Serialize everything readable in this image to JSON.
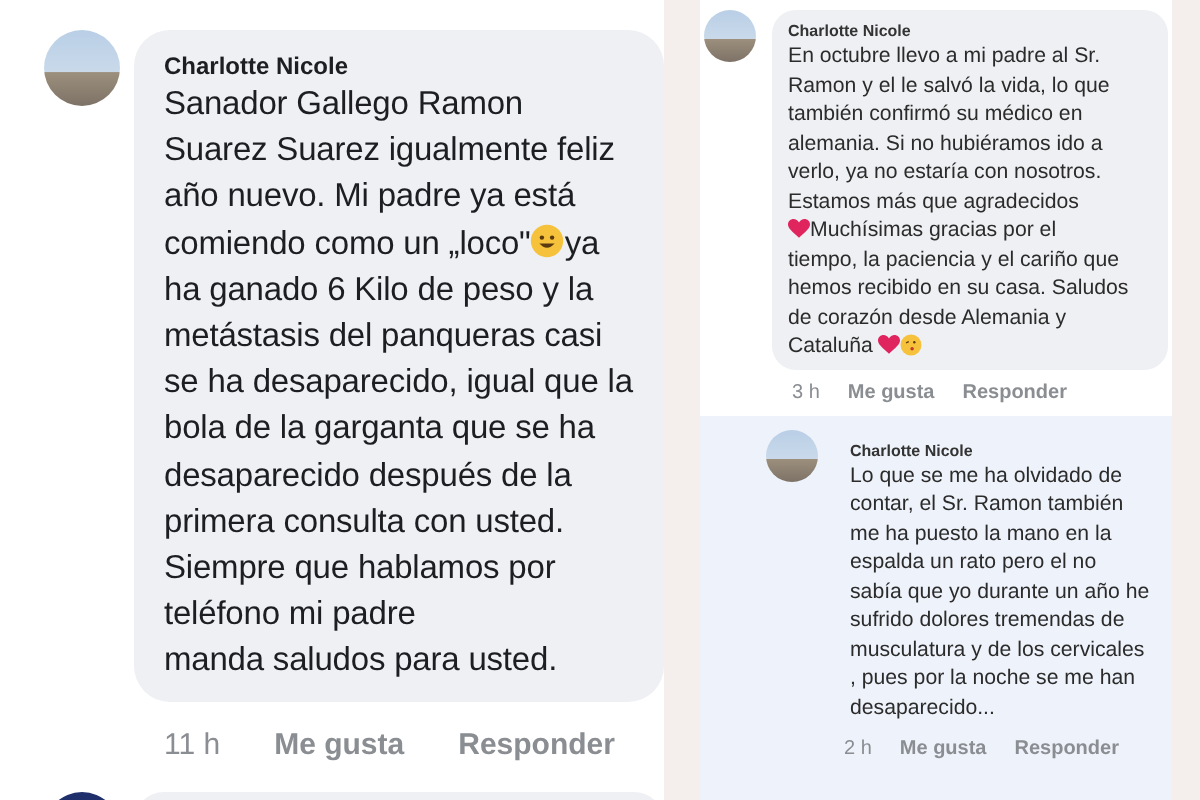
{
  "left_panel": {
    "comment": {
      "author": "Charlotte Nicole",
      "body": [
        {
          "kind": "text",
          "text": "Sanador Gallego Ramon\nSuarez Suarez igualmente feliz\naño nuevo. Mi padre ya está\ncomiendo como un „loco\""
        },
        {
          "kind": "smile"
        },
        {
          "kind": "text",
          "text": "ya\nha ganado 6 Kilo de peso y la\nmetástasis del panqueras casi\nse ha desaparecido, igual que la\nbola de la garganta que se ha\ndesaparecido después de la\nprimera consulta con usted.\nSiempre que hablamos por\nteléfono mi padre\nmanda saludos para usted."
        }
      ],
      "time": "11 h",
      "actions": [
        "Me gusta",
        "Responder"
      ]
    }
  },
  "right_panel": {
    "comments": [
      {
        "author": "Charlotte Nicole",
        "reply": false,
        "body": [
          {
            "kind": "text",
            "text": "En octubre llevo a mi padre al Sr.\nRamon y el le salvó la vida, lo que\ntambién confirmó su médico en\nalemania. Si no hubiéramos ido a\nverlo, ya no estaría con nosotros.\nEstamos más que agradecidos\n"
          },
          {
            "kind": "heart"
          },
          {
            "kind": "text",
            "text": "Muchísimas gracias por el\ntiempo, la paciencia y el cariño que\nhemos recibido en su casa. Saludos\nde corazón desde Alemania  y\nCataluña "
          },
          {
            "kind": "heart"
          },
          {
            "kind": "kiss"
          }
        ],
        "time": "3 h",
        "actions": [
          "Me gusta",
          "Responder"
        ]
      },
      {
        "author": "Charlotte Nicole",
        "reply": true,
        "body": [
          {
            "kind": "text",
            "text": "Lo que se me ha olvidado de\ncontar, el Sr. Ramon también\nme ha puesto la mano en la\nespalda un rato pero el no\nsabía que yo durante un año he\nsufrido dolores tremendas de\nmusculatura y de los cervicales\n, pues por la noche se me han\ndesaparecido..."
          }
        ],
        "time": "2 h",
        "actions": [
          "Me gusta",
          "Responder"
        ]
      }
    ]
  }
}
